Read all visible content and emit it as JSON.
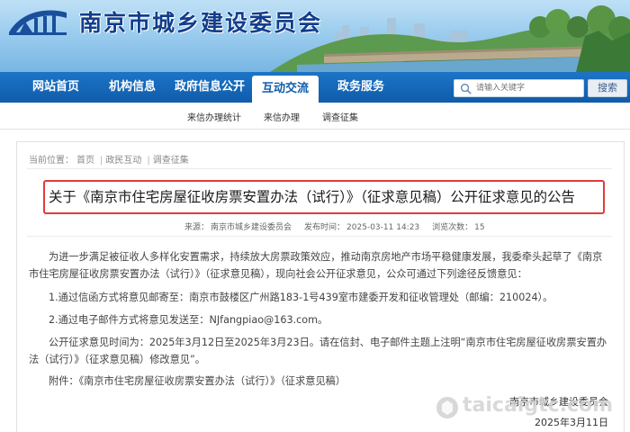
{
  "site": {
    "name": "南京市城乡建设委员会"
  },
  "nav": {
    "items": [
      "网站首页",
      "机构信息",
      "政府信息公开",
      "互动交流",
      "政务服务"
    ],
    "active": "互动交流"
  },
  "search": {
    "placeholder": "请输入关键字",
    "button_label": "搜索"
  },
  "subnav": {
    "items": [
      "来信办理统计",
      "来信办理",
      "调查征集"
    ]
  },
  "breadcrumb": {
    "prefix": "当前位置：",
    "items": [
      "首页",
      "政民互动",
      "调查征集"
    ]
  },
  "article": {
    "title": "关于《南京市住宅房屋征收房票安置办法（试行）》（征求意见稿）公开征求意见的公告",
    "source_label": "来源：",
    "source": "南京市城乡建设委员会",
    "time_label": "发布时间：",
    "time": "2025-03-11 14:23",
    "views_label": "浏览次数：",
    "views": "15",
    "paragraphs": [
      "为进一步满足被征收人多样化安置需求，持续放大房票政策效应，推动南京房地产市场平稳健康发展，我委牵头起草了《南京",
      "市住宅房屋征收房票安置办法（试行）》（征求意见稿），现向社会公开征求意见，公众可通过下列途径反馈意见：",
      "1.通过信函方式将意见邮寄至：南京市鼓楼区广州路183-1号439室市建委开发和征收管理处（邮编：210024）。",
      "2.通过电子邮件方式将意见发送至：NJfangpiao@163.com。",
      "公开征求意见时间为：2025年3月12日至2025年3月23日。请在信封、电子邮件主题上注明“南京市住宅房屋征收房票安置办",
      "法（试行）》（征求意见稿）修改意见”。",
      "附件：《南京市住宅房屋征收房票安置办法（试行）》（征求意见稿）"
    ],
    "signature_org": "南京市城乡建设委员会",
    "signature_date": "2025年3月11日"
  },
  "watermark": {
    "text": "taicaigtc.com"
  },
  "colors": {
    "nav_blue": "#0f5cab",
    "title_border": "#e23a3a",
    "site_name": "#123e8c"
  },
  "icons": {
    "logo": "bridge-logo-icon",
    "search": "search-icon"
  }
}
